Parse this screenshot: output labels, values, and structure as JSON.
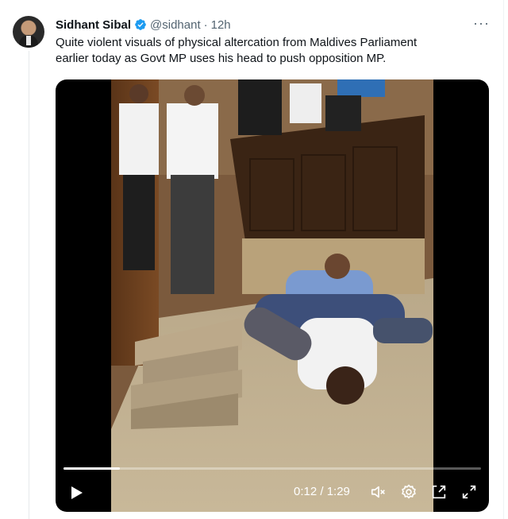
{
  "tweet": {
    "author_name": "Sidhant Sibal",
    "handle": "@sidhant",
    "separator": "·",
    "time": "12h",
    "text_lines": [
      "Quite violent visuals of physical altercation from Maldives Parliament",
      "earlier today as Govt MP uses his head to push opposition MP."
    ],
    "more_label": "···"
  },
  "video": {
    "current_time": "0:12",
    "duration": "1:29",
    "time_display": "0:12 / 1:29",
    "progress": 0.135
  },
  "icons": {
    "verified": "verified-badge-icon",
    "play": "play-icon",
    "mute": "volume-muted-icon",
    "settings": "settings-gear-icon",
    "dock": "picture-in-picture-icon",
    "fullscreen": "fullscreen-icon"
  },
  "colors": {
    "verified_blue": "#1d9bf0",
    "secondary_text": "#536471",
    "primary_text": "#0f1419"
  }
}
